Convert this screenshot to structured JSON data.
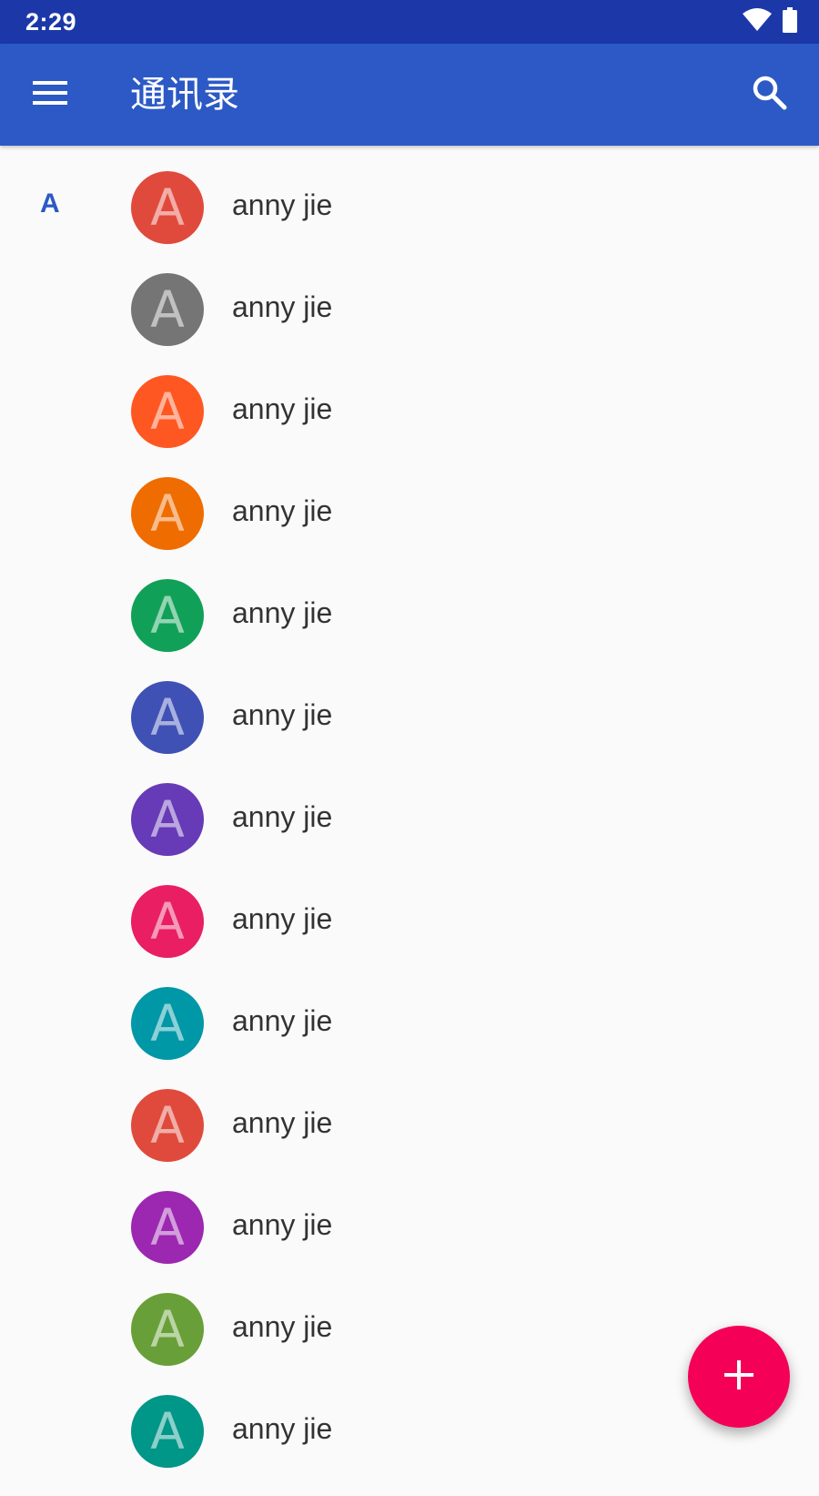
{
  "status_bar": {
    "time": "2:29",
    "icons": [
      "wifi-icon",
      "battery-icon"
    ]
  },
  "app_bar": {
    "menu_icon": "menu-icon",
    "title": "通讯录",
    "search_icon": "search-icon",
    "color": "#2c59c5"
  },
  "section": {
    "letter": "A"
  },
  "contacts": [
    {
      "initial": "A",
      "name": "anny jie",
      "color": "#e04a3c"
    },
    {
      "initial": "A",
      "name": "anny jie",
      "color": "#757575"
    },
    {
      "initial": "A",
      "name": "anny jie",
      "color": "#ff5722"
    },
    {
      "initial": "A",
      "name": "anny jie",
      "color": "#ef6c00"
    },
    {
      "initial": "A",
      "name": "anny jie",
      "color": "#11a058"
    },
    {
      "initial": "A",
      "name": "anny jie",
      "color": "#3f51b5"
    },
    {
      "initial": "A",
      "name": "anny jie",
      "color": "#673ab7"
    },
    {
      "initial": "A",
      "name": "anny jie",
      "color": "#e91e63"
    },
    {
      "initial": "A",
      "name": "anny jie",
      "color": "#0097a7"
    },
    {
      "initial": "A",
      "name": "anny jie",
      "color": "#e04a3c"
    },
    {
      "initial": "A",
      "name": "anny jie",
      "color": "#9c27b0"
    },
    {
      "initial": "A",
      "name": "anny jie",
      "color": "#689f38"
    },
    {
      "initial": "A",
      "name": "anny jie",
      "color": "#009688"
    }
  ],
  "fab": {
    "icon": "plus-icon",
    "color": "#f50057"
  }
}
